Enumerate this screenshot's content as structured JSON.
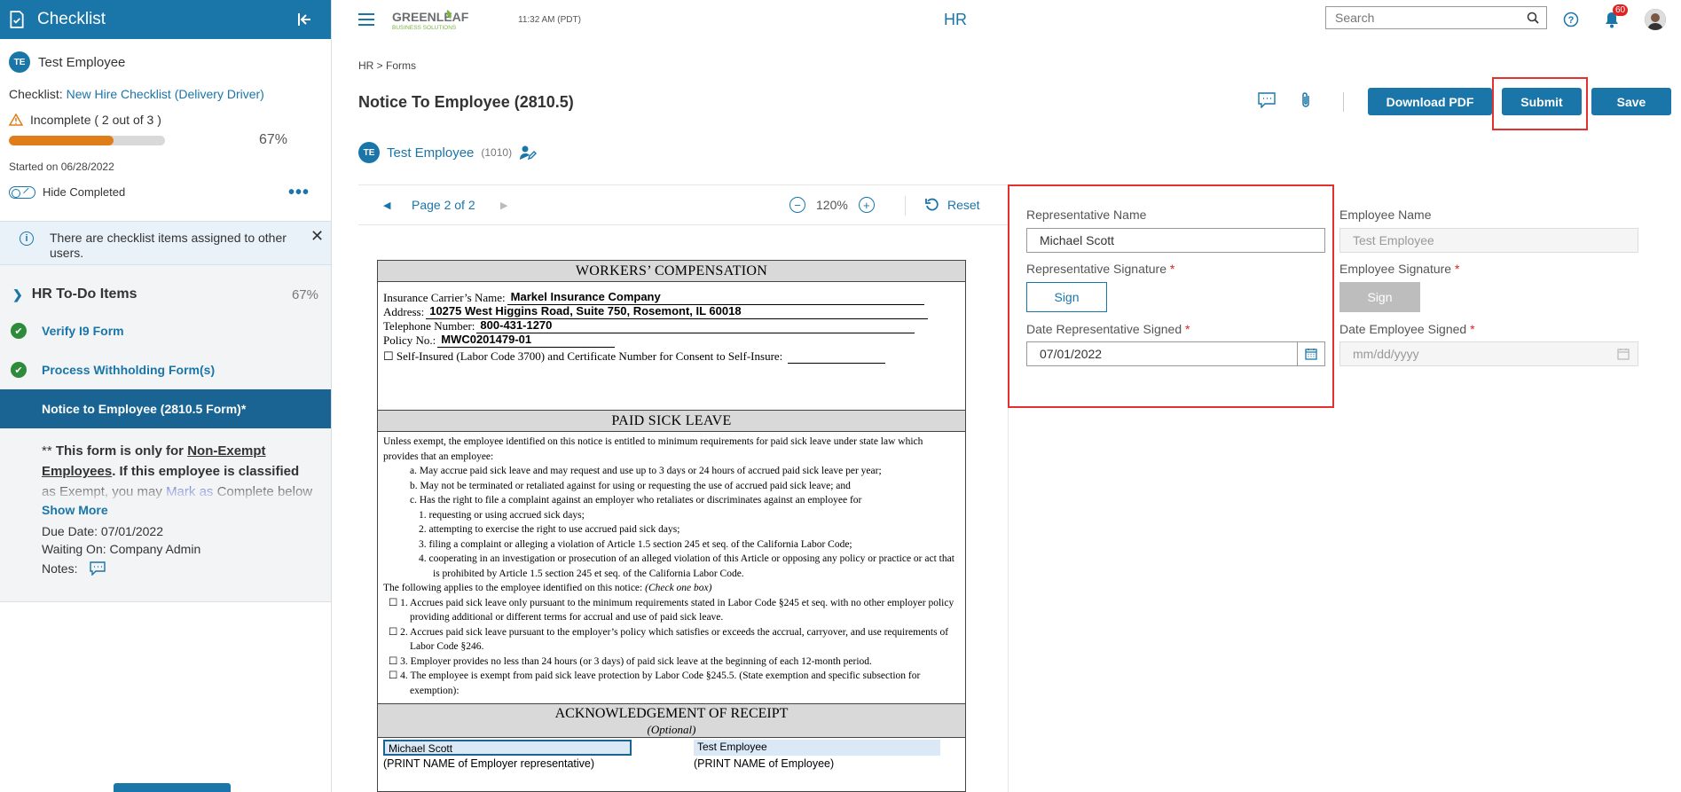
{
  "sidebar": {
    "title": "Checklist",
    "employee": {
      "initials": "TE",
      "name": "Test Employee"
    },
    "checklist_label": "Checklist:",
    "checklist_name": "New Hire Checklist (Delivery Driver)",
    "status": "Incomplete ( 2 out of 3 )",
    "progress_percent": 67,
    "progress_label": "67%",
    "started": "Started on 06/28/2022",
    "hide_completed": "Hide Completed",
    "more": "•••",
    "info": "There are checklist items assigned to other users.",
    "section": {
      "label": "HR To-Do Items",
      "pct": "67%"
    },
    "items": [
      {
        "label": "Verify I9 Form",
        "state": "complete"
      },
      {
        "label": "Process Withholding Form(s)",
        "state": "complete"
      },
      {
        "label": "Notice to Employee (2810.5 Form)*",
        "state": "active"
      }
    ],
    "note": {
      "prefix": "** ",
      "bold1": "This form is only for ",
      "underline1": "Non-Exempt Employees",
      "bold2": ". If this employee is classified",
      "plain": " as Exempt, you may ",
      "link": "Mark as",
      "tail": " Complete below this item."
    },
    "show_more": "Show More",
    "due_date": "Due Date: 07/01/2022",
    "waiting_on": "Waiting On: Company Admin",
    "notes": "Notes:"
  },
  "topbar": {
    "time": "11:32 AM (PDT)",
    "section": "HR",
    "search_placeholder": "Search",
    "notifications": "60",
    "logo_line1": "GREENLEAF",
    "logo_line2": "BUSINESS SOLUTIONS"
  },
  "breadcrumb": "HR > Forms",
  "page_title": "Notice To Employee (2810.5)",
  "buttons": {
    "download": "Download PDF",
    "submit": "Submit",
    "save": "Save"
  },
  "employee": {
    "initials": "TE",
    "name": "Test Employee",
    "id": "(1010)"
  },
  "doc_toolbar": {
    "page": "Page 2 of 2",
    "zoom": "120%",
    "reset": "Reset"
  },
  "document": {
    "sec1_title": "WORKERS’ COMPENSATION",
    "carrier_label": "Insurance Carrier’s Name:",
    "carrier": "Markel  Insurance Company",
    "address_label": "Address:",
    "address": "10275 West Higgins Road, Suite 750, Rosemont, IL 60018",
    "phone_label": "Telephone Number:",
    "phone": "800-431-1270",
    "policy_label": "Policy No.:",
    "policy": "MWC0201479-01",
    "self_insured": "☐    Self-Insured (Labor Code 3700) and Certificate Number for Consent to Self-Insure:",
    "sec2_title": "PAID SICK LEAVE",
    "sick_intro": "Unless exempt, the employee identified on this notice is entitled to minimum requirements for paid sick leave under state law which provides that an employee:",
    "sick_a": "a.  May accrue paid sick leave and may request and use up to 3 days or 24 hours of accrued paid sick leave per year;",
    "sick_b": "b.  May not be terminated or retaliated against for using or requesting the use of accrued paid sick leave; and",
    "sick_c": "c.  Has the right to file a complaint against an employer who retaliates or discriminates against an employee for",
    "sick_c1": "1.  requesting or using accrued sick days;",
    "sick_c2": "2.  attempting to exercise the right to use accrued paid sick days;",
    "sick_c3": "3.  filing a complaint or alleging a violation of Article 1.5 section 245 et seq. of the California Labor Code;",
    "sick_c4": "4.  cooperating in an investigation or prosecution of an alleged violation of this Article or opposing any policy or practice or act that is prohibited by Article 1.5 section 245 et seq. of the California Labor Code.",
    "applies": "The following applies to the employee identified on this notice:",
    "applies_note": "(Check one box)",
    "opt1": "☐  1.  Accrues paid sick leave only pursuant to the minimum requirements stated in Labor Code §245 et seq. with no other employer policy providing additional or different terms for accrual and use of paid sick leave.",
    "opt2": "☐  2.  Accrues paid sick leave pursuant to the employer’s policy which satisfies or exceeds the accrual, carryover, and use requirements of Labor Code §246.",
    "opt3": "☐  3.  Employer provides no less than 24 hours (or 3 days) of paid sick leave at the beginning of each 12-month period.",
    "opt4": "☐  4.  The employee is exempt from paid sick leave protection by Labor Code §245.5. (State exemption and specific subsection for exemption):",
    "sec3_title": "ACKNOWLEDGEMENT OF RECEIPT",
    "sec3_sub": "(Optional)",
    "ack_rep_name": "Michael Scott",
    "ack_emp_name": "Test Employee",
    "ack_rep_label": "(PRINT NAME of Employer representative)",
    "ack_emp_label": "(PRINT NAME of Employee)"
  },
  "form": {
    "rep_name_label": "Representative Name",
    "rep_name_value": "Michael Scott",
    "rep_sig_label": "Representative Signature",
    "rep_sign_btn": "Sign",
    "rep_date_label": "Date Representative Signed",
    "rep_date_value": "07/01/2022",
    "emp_name_label": "Employee Name",
    "emp_name_value": "Test Employee",
    "emp_sig_label": "Employee Signature",
    "emp_sign_btn": "Sign",
    "emp_date_label": "Date Employee Signed",
    "emp_date_placeholder": "mm/dd/yyyy",
    "required_mark": "*"
  },
  "colors": {
    "brand": "#1a75a9",
    "progress": "#e07d1b",
    "success": "#2e8b3b",
    "highlight": "#e53030"
  }
}
